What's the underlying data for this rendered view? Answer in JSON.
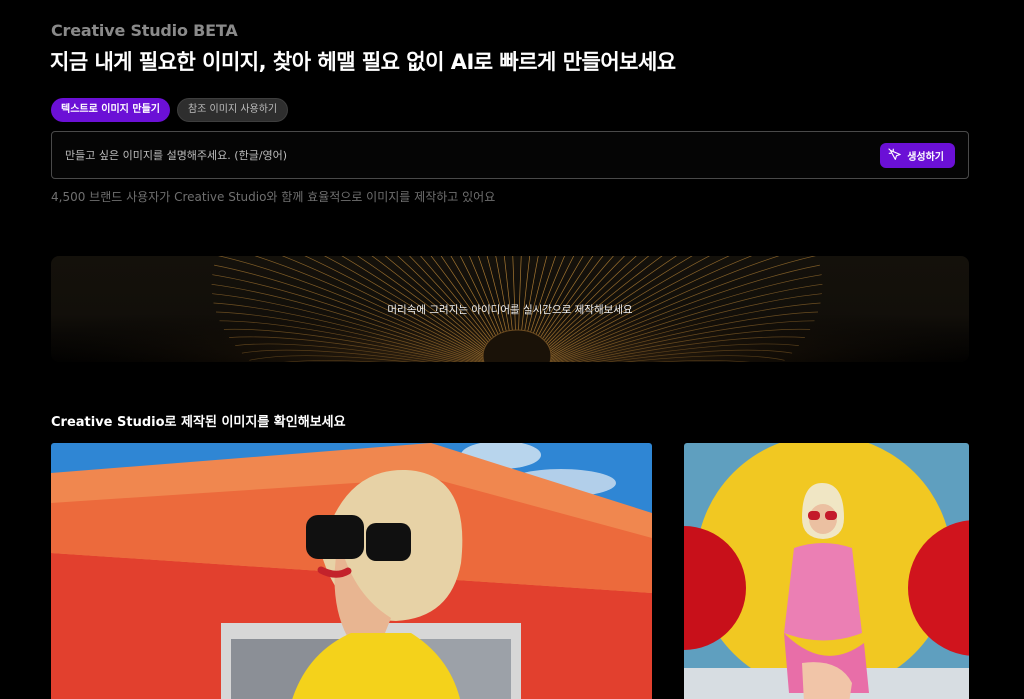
{
  "header": {
    "brand": "Creative Studio BETA",
    "headline": "지금 내게 필요한 이미지, 찾아 헤맬 필요 없이 AI로 빠르게 만들어보세요"
  },
  "tabs": [
    {
      "label": "텍스트로 이미지 만들기",
      "active": true
    },
    {
      "label": "참조 이미지 사용하기",
      "active": false
    }
  ],
  "prompt": {
    "placeholder": "만들고 싶은 이미지를 설명해주세요. (한글/영어)",
    "value": "",
    "generate_label": "생성하기"
  },
  "users_line": "4,500 브랜드 사용자가 Creative Studio와 함께 효율적으로 이미지를 제작하고 있어요",
  "banner": {
    "text": "머리속에 그려지는 아이디어를 실시간으로 제작해보세요"
  },
  "gallery": {
    "title": "Creative Studio로 제작된 이미지를 확인해보세요",
    "items": [
      {
        "image": "woman-with-sunglasses-orange-building"
      },
      {
        "image": "woman-in-pink-dress-red-spheres"
      }
    ]
  },
  "colors": {
    "accent": "#6b10d6",
    "background": "#000000",
    "muted_text": "#6f6f6f"
  }
}
